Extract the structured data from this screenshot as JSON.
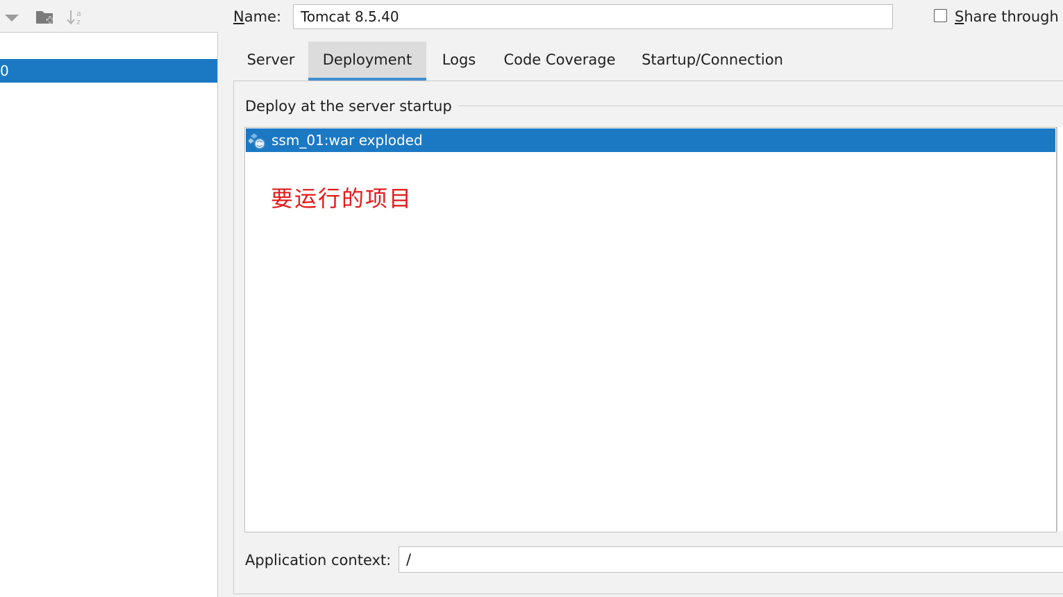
{
  "left_panel": {
    "toolbar": {
      "collapse_icon": "chevron-down-icon",
      "new_folder_icon": "folder-plus-icon",
      "sort_icon": "sort-alpha-icon"
    },
    "tree": {
      "selected_item_text": "0"
    }
  },
  "name_row": {
    "label": "Name:",
    "value": "Tomcat 8.5.40",
    "share_label": "Share through V",
    "share_checked": false
  },
  "tabs": [
    {
      "label": "Server",
      "active": false
    },
    {
      "label": "Deployment",
      "active": true
    },
    {
      "label": "Logs",
      "active": false
    },
    {
      "label": "Code Coverage",
      "active": false
    },
    {
      "label": "Startup/Connection",
      "active": false
    }
  ],
  "deployment": {
    "section_title": "Deploy at the server startup",
    "items": [
      {
        "label": "ssm_01:war exploded",
        "icon": "artifact-icon",
        "selected": true
      }
    ],
    "annotation": "要运行的项目",
    "app_context_label": "Application context:",
    "app_context_value": "/"
  },
  "colors": {
    "selection": "#1b79c4",
    "tab_active_underline": "#3f8fd2",
    "annotation": "#e31a1a"
  }
}
